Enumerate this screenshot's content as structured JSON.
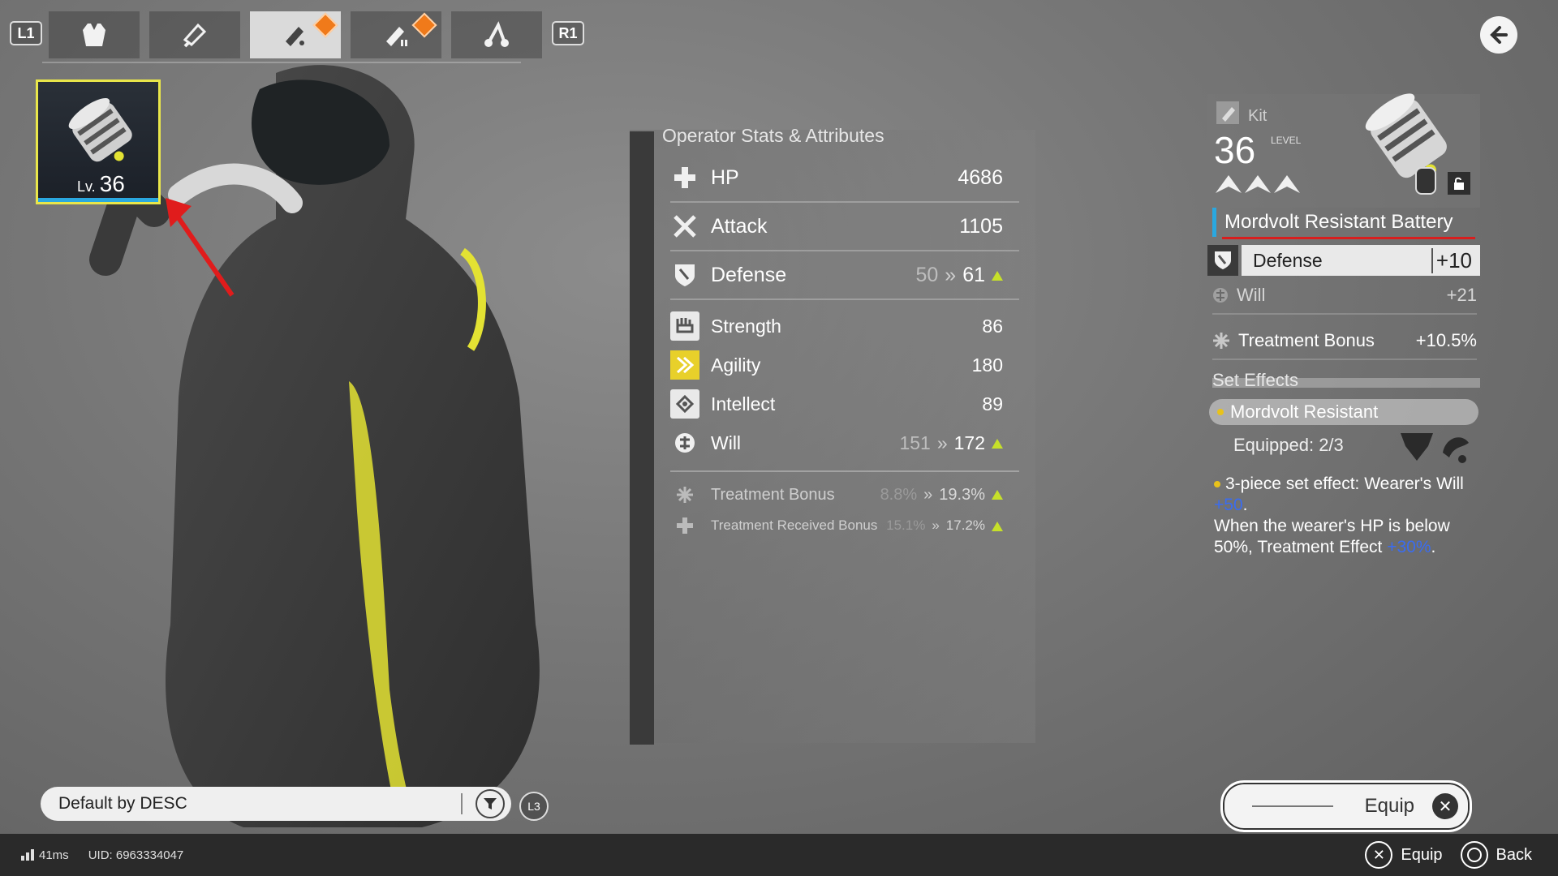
{
  "top_nav": {
    "l1_label": "L1",
    "r1_label": "R1",
    "tabs": [
      {
        "icon": "armor-icon"
      },
      {
        "icon": "gloves-icon"
      },
      {
        "icon": "kit-icon",
        "active": true,
        "badge": true
      },
      {
        "icon": "kit-2-icon",
        "badge": true
      },
      {
        "icon": "weapon-icon"
      }
    ]
  },
  "item_tile": {
    "lv_prefix": "Lv.",
    "level": "36"
  },
  "stats": {
    "title": "Operator Stats & Attributes",
    "rows": [
      {
        "name": "HP",
        "value": "4686"
      },
      {
        "name": "Attack",
        "value": "1105"
      },
      {
        "name": "Defense",
        "old": "50",
        "arrow": "»",
        "new": "61"
      },
      {
        "name": "Strength",
        "value": "86"
      },
      {
        "name": "Agility",
        "value": "180"
      },
      {
        "name": "Intellect",
        "value": "89"
      },
      {
        "name": "Will",
        "old": "151",
        "arrow": "»",
        "new": "172"
      },
      {
        "name": "Treatment Bonus",
        "old": "8.8%",
        "arrow": "»",
        "new": "19.3%"
      },
      {
        "name": "Treatment Received Bonus",
        "old": "15.1%",
        "arrow": "»",
        "new": "17.2%"
      }
    ]
  },
  "gear": {
    "type": "Kit",
    "level": "36",
    "level_label": "LEVEL",
    "name": "Mordvolt Resistant Battery",
    "primary": {
      "name": "Defense",
      "value": "+10"
    },
    "secondary": [
      {
        "name": "Will",
        "value": "+21"
      },
      {
        "name": "Treatment Bonus",
        "value": "+10.5%"
      }
    ],
    "set_effects_title": "Set Effects",
    "set_name": "Mordvolt Resistant",
    "equipped": "Equipped: 2/3",
    "effect_a": "3-piece set effect: Wearer's Will ",
    "effect_a_val": "+50",
    "effect_b": "When the wearer's HP is below 50%, Treatment Effect ",
    "effect_b_val": "+30%"
  },
  "sort": {
    "label": "Default by DESC",
    "l3": "L3"
  },
  "equip_button": "Equip",
  "footer": {
    "ping": "41ms",
    "uid": "UID: 6963334047",
    "equip_hint": "Equip",
    "back_hint": "Back"
  },
  "colors": {
    "accent_yellow": "#e9e64a",
    "accent_blue": "#2aa8e0",
    "increase_green": "#c6e02a",
    "underline_red": "#d81e1e"
  }
}
